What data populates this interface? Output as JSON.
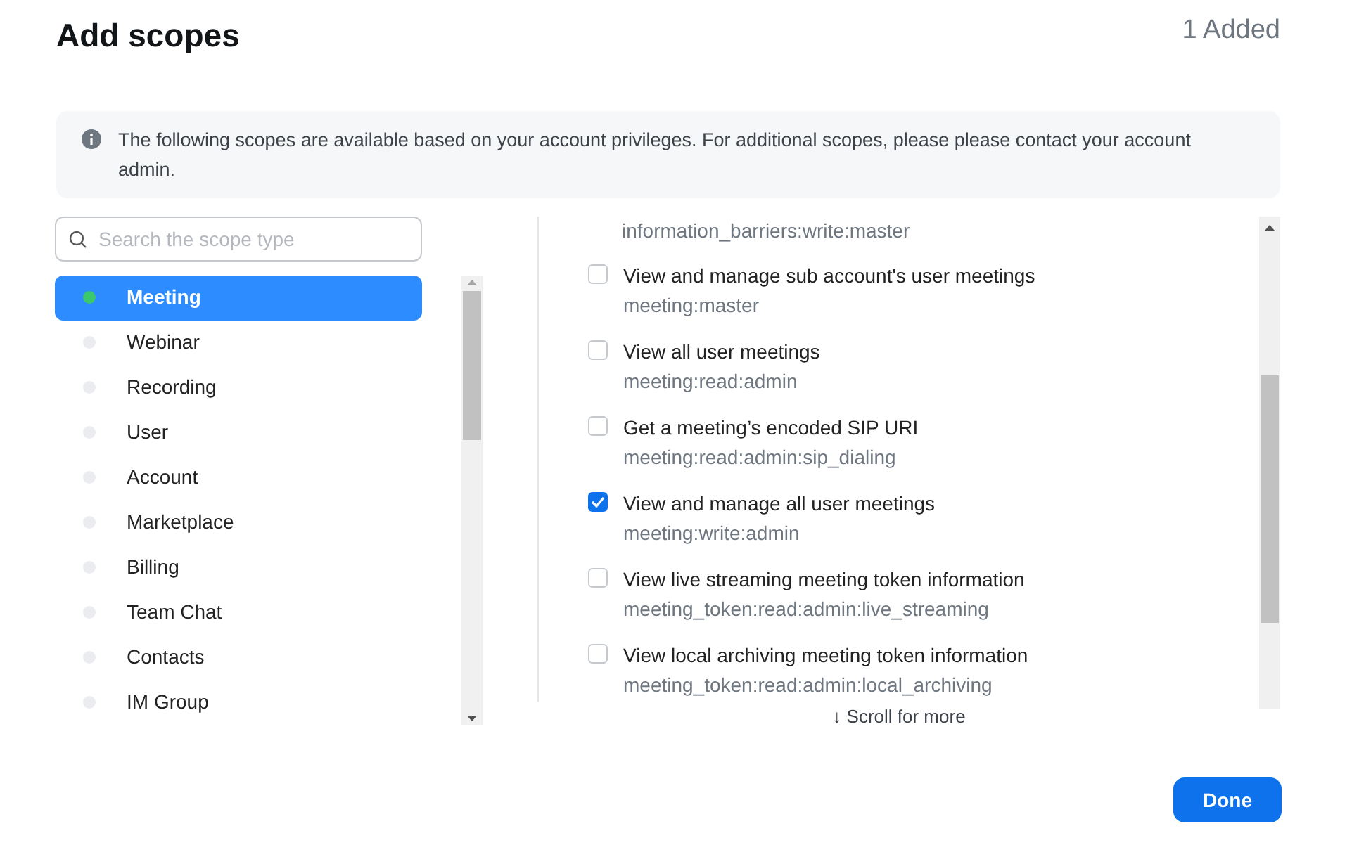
{
  "title": "Add scopes",
  "added_count": "1 Added",
  "notice": "The following scopes are available based on your account privileges. For additional scopes, please please contact your account admin.",
  "search": {
    "placeholder": "Search the scope type"
  },
  "categories": [
    {
      "label": "Meeting",
      "selected": true
    },
    {
      "label": "Webinar",
      "selected": false
    },
    {
      "label": "Recording",
      "selected": false
    },
    {
      "label": "User",
      "selected": false
    },
    {
      "label": "Account",
      "selected": false
    },
    {
      "label": "Marketplace",
      "selected": false
    },
    {
      "label": "Billing",
      "selected": false
    },
    {
      "label": "Team Chat",
      "selected": false
    },
    {
      "label": "Contacts",
      "selected": false
    },
    {
      "label": "IM Group",
      "selected": false
    }
  ],
  "clipped_scope": "information_barriers:write:master",
  "scopes": [
    {
      "title": "View and manage sub account's user meetings",
      "scope": "meeting:master",
      "checked": false
    },
    {
      "title": "View all user meetings",
      "scope": "meeting:read:admin",
      "checked": false
    },
    {
      "title": "Get a meeting’s encoded SIP URI",
      "scope": "meeting:read:admin:sip_dialing",
      "checked": false
    },
    {
      "title": "View and manage all user meetings",
      "scope": "meeting:write:admin",
      "checked": true
    },
    {
      "title": "View live streaming meeting token information",
      "scope": "meeting_token:read:admin:live_streaming",
      "checked": false
    },
    {
      "title": "View local archiving meeting token information",
      "scope": "meeting_token:read:admin:local_archiving",
      "checked": false
    }
  ],
  "scroll_hint": "↓ Scroll for more",
  "done_button": "Done"
}
